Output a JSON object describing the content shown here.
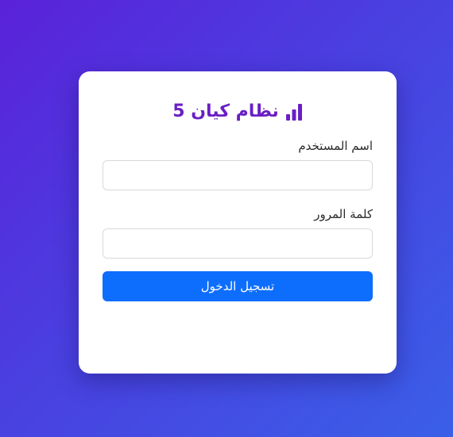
{
  "login": {
    "title": "نظام كيان 5",
    "brand_icon": "bar-chart-icon",
    "username_label": "اسم المستخدم",
    "username_value": "",
    "password_label": "كلمة المرور",
    "password_value": "",
    "submit_label": "تسجيل الدخول"
  },
  "colors": {
    "background_start": "#5a22d9",
    "background_end": "#3a5fe8",
    "brand": "#6a1fc4",
    "button": "#0d6efd"
  }
}
